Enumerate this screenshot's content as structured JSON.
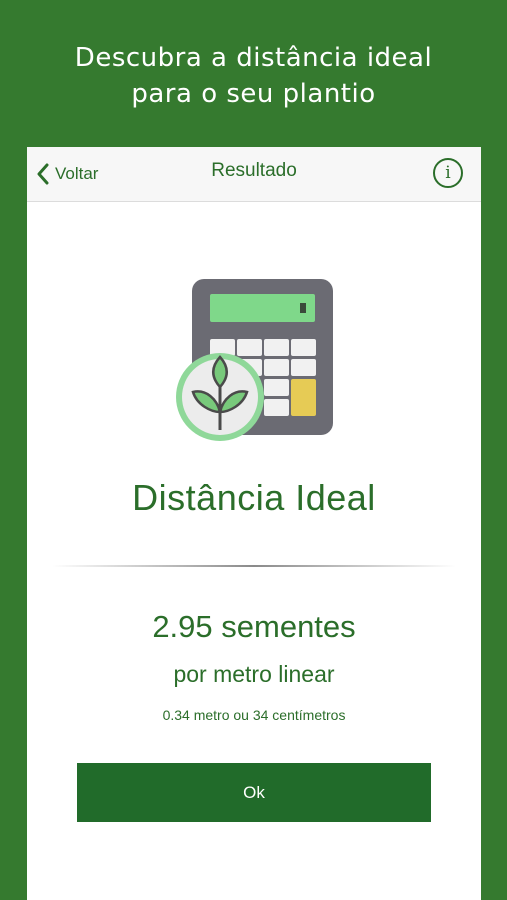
{
  "promo": {
    "line1": "Descubra a distância ideal",
    "line2": "para o seu plantio"
  },
  "navbar": {
    "back_label": "Voltar",
    "title": "Resultado",
    "info_icon": "info-icon",
    "info_glyph": "i"
  },
  "illustration": {
    "icon": "calculator-with-sprout-icon"
  },
  "result": {
    "heading": "Distância Ideal",
    "value": "2.95 sementes",
    "unit": "por metro linear",
    "detail": "0.34 metro ou 34 centímetros"
  },
  "actions": {
    "ok_label": "Ok"
  },
  "colors": {
    "background": "#357a2f",
    "accent": "#2b6e2a",
    "button": "#216b2a"
  }
}
